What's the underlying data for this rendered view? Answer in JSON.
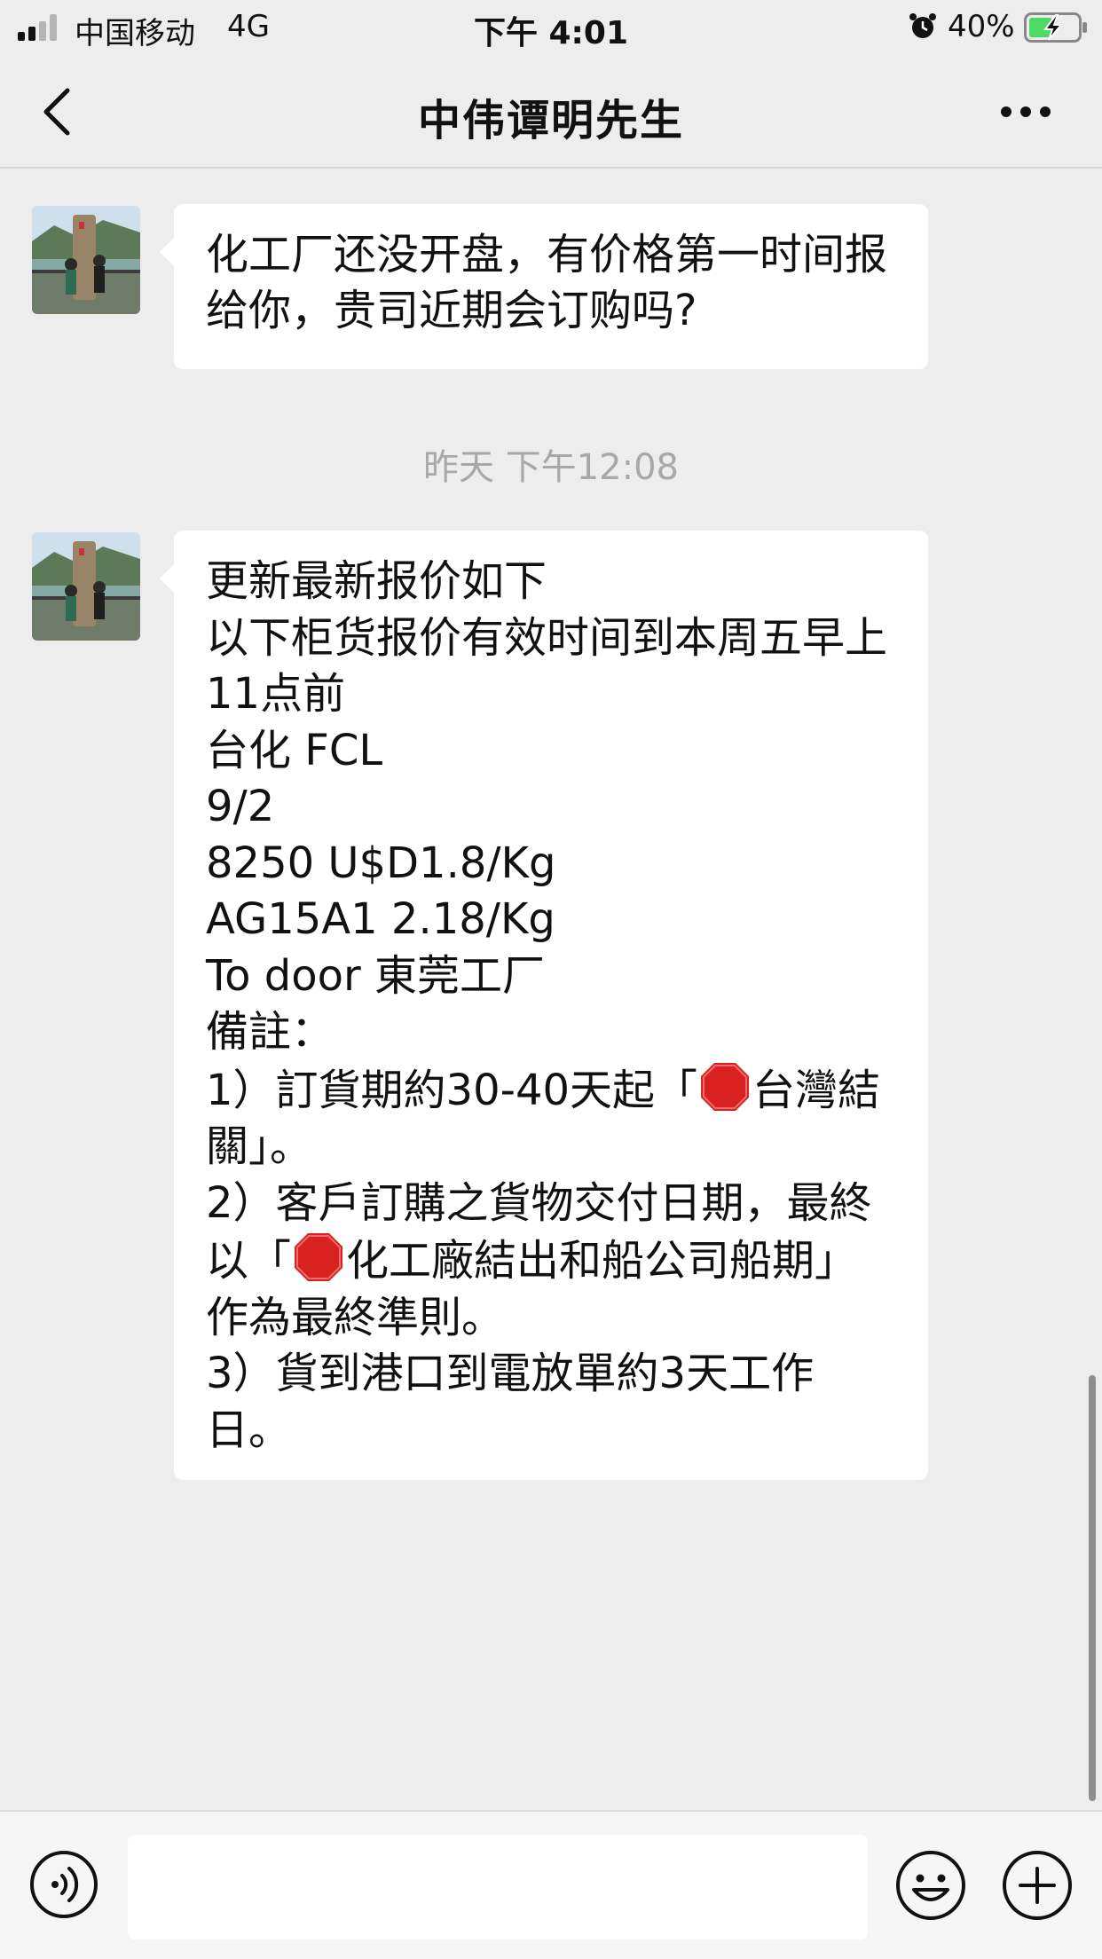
{
  "status_bar": {
    "carrier": "中国移动",
    "network": "4G",
    "time": "下午 4:01",
    "battery": "40%"
  },
  "nav": {
    "title": "中伟谭明先生",
    "back_icon": "chevron-left-icon",
    "more_icon": "more-dots-icon"
  },
  "messages": [
    {
      "sender": "中伟谭明先生",
      "text": "化工厂还没开盘，有价格第一时间报给你，贵司近期会订购吗?"
    },
    {
      "sender": "中伟谭明先生",
      "lines": [
        "更新最新报价如下",
        "以下柜货报价有效时间到本周五早上11点前",
        "台化 FCL",
        "9/2",
        "8250 U$D1.8/Kg",
        "AG15A1 2.18/Kg",
        "To door 東莞工厂",
        "備註：",
        "1）訂貨期約30-40天起「",
        "台灣結關」。",
        "2）客戶訂購之貨物交付日期，最終以「",
        "化工廠結出和船公司船期」作為最終準則。",
        "3）貨到港口到電放單約3天工作日。"
      ]
    }
  ],
  "timestamp": "昨天 下午12:08",
  "input_bar": {
    "placeholder": "",
    "voice_icon": "voice-icon",
    "emoji_icon": "emoji-icon",
    "plus_icon": "plus-icon"
  }
}
